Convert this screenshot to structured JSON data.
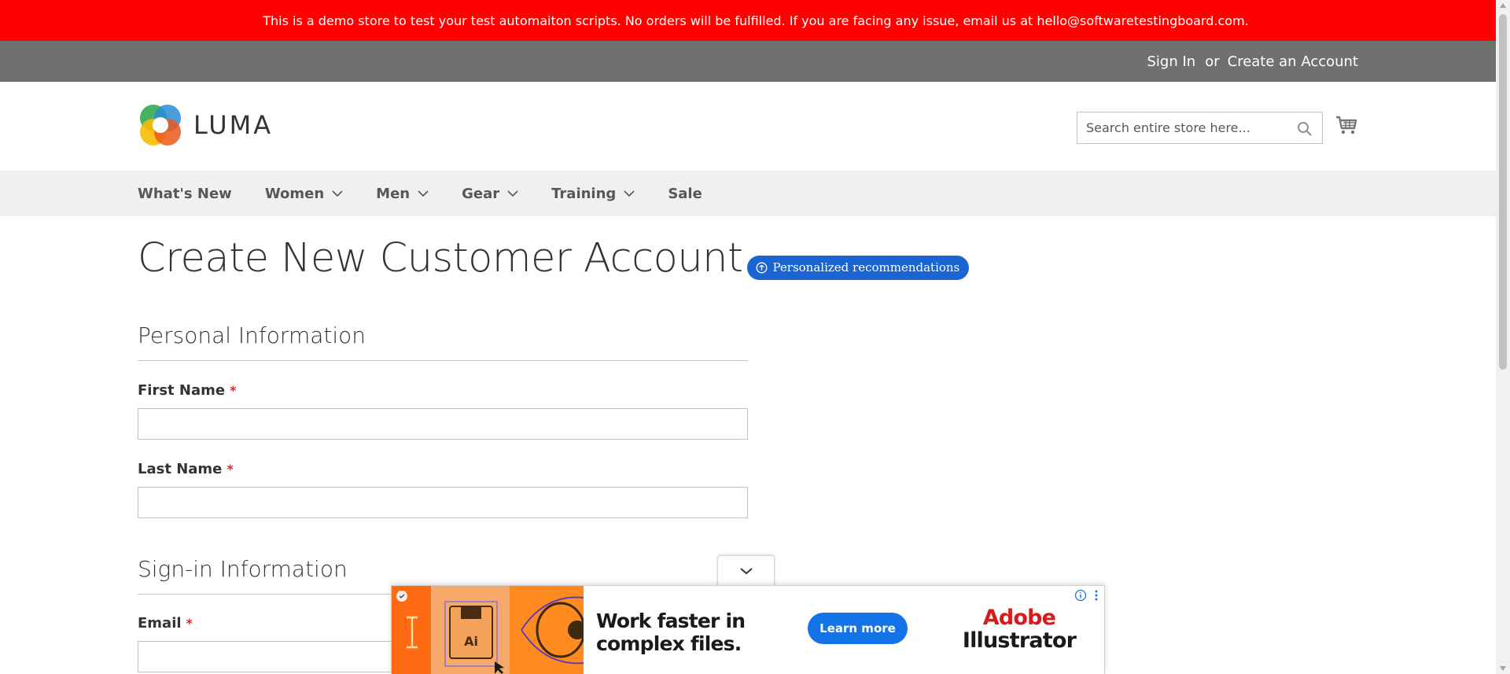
{
  "demo_banner": {
    "text": "This is a demo store to test your test automaiton scripts. No orders will be fulfilled. If you are facing any issue, email us at hello@softwaretestingboard.com.",
    "color": "#ff0101"
  },
  "top_links": {
    "sign_in": "Sign In",
    "or": "or",
    "create_account": "Create an Account"
  },
  "header": {
    "logo_text": "LUMA",
    "search_placeholder": "Search entire store here...",
    "icons": [
      "luma-logo-icon",
      "search-icon",
      "cart-icon"
    ]
  },
  "nav": {
    "items": [
      {
        "label": "What's New",
        "has_submenu": false
      },
      {
        "label": "Women",
        "has_submenu": true
      },
      {
        "label": "Men",
        "has_submenu": true
      },
      {
        "label": "Gear",
        "has_submenu": true
      },
      {
        "label": "Training",
        "has_submenu": true
      },
      {
        "label": "Sale",
        "has_submenu": false
      }
    ]
  },
  "page": {
    "title": "Create New Customer Account",
    "reco_badge": "Personalized recommendations",
    "reco_color": "#1a64d3"
  },
  "form": {
    "personal_section": "Personal Information",
    "first_name_label": "First Name",
    "last_name_label": "Last Name",
    "signin_section": "Sign-in Information",
    "email_label": "Email",
    "required_mark": "*",
    "first_name_value": "",
    "last_name_value": "",
    "email_value": ""
  },
  "ad": {
    "headline": "Work faster in complex files.",
    "cta": "Learn more",
    "brand_line1": "Adobe",
    "brand_line2": "Illustrator",
    "art_label": "Ai",
    "cta_color": "#1473e6"
  }
}
